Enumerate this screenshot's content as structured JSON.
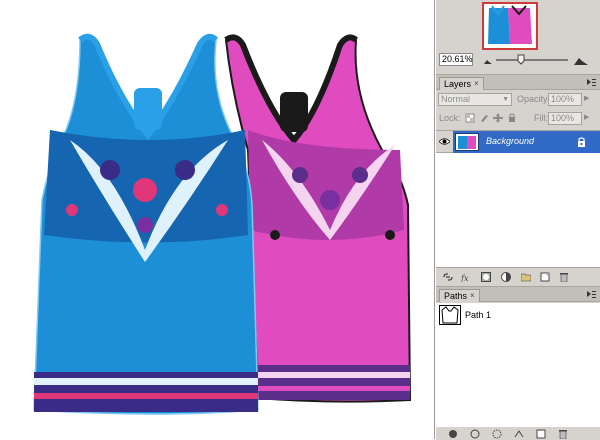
{
  "navigator": {
    "zoom_value": "20.61%",
    "zoom_out_icon": "small-mountain-icon",
    "zoom_in_icon": "large-mountain-icon"
  },
  "layers_panel": {
    "tab_label": "Layers",
    "tab_close": "×",
    "blend_mode": "Normal",
    "opacity_label": "Opacity:",
    "opacity_value": "100%",
    "lock_label": "Lock:",
    "fill_label": "Fill:",
    "fill_value": "100%",
    "layers": [
      {
        "name": "Background",
        "visible": true,
        "locked": true,
        "selected": true
      }
    ],
    "footer_icons": [
      "link-layers-icon",
      "fx-icon",
      "mask-icon",
      "adjustment-icon",
      "group-icon",
      "new-layer-icon",
      "trash-icon"
    ]
  },
  "paths_panel": {
    "tab_label": "Paths",
    "tab_close": "×",
    "paths": [
      {
        "name": "Path 1"
      }
    ],
    "footer_icons": [
      "fill-path-icon",
      "stroke-path-icon",
      "load-selection-icon",
      "make-path-icon",
      "new-path-icon",
      "trash-icon"
    ]
  },
  "colors": {
    "panel_bg": "#d6d3ce",
    "selection_blue": "#3169c6",
    "navigator_frame": "#cc3a3a",
    "shirt_blue": "#1d8fd6",
    "shirt_pink": "#e04cbf",
    "strap_black": "#1a1a1a"
  }
}
